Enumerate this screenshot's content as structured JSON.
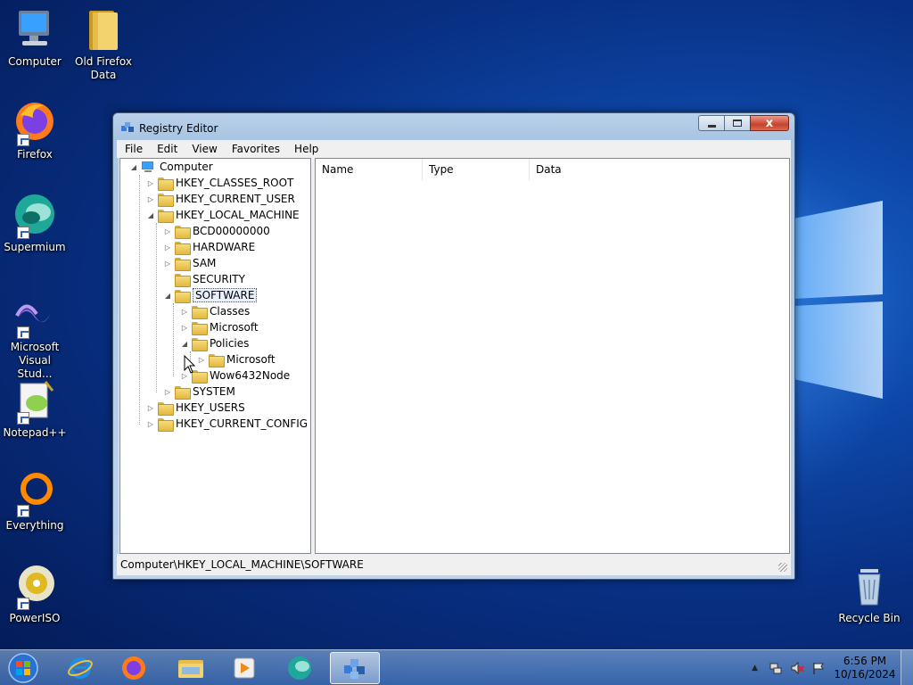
{
  "desktop": {
    "icons": [
      {
        "label": "Computer",
        "icon": "computer-icon"
      },
      {
        "label": "Old Firefox Data",
        "icon": "folder-icon"
      },
      {
        "label": "Firefox",
        "icon": "firefox-icon"
      },
      {
        "label": "Supermium",
        "icon": "supermium-icon"
      },
      {
        "label": "Microsoft Visual Stud...",
        "icon": "visual-studio-icon"
      },
      {
        "label": "Notepad++",
        "icon": "notepadpp-icon"
      },
      {
        "label": "Everything",
        "icon": "everything-icon"
      },
      {
        "label": "PowerISO",
        "icon": "poweriso-icon"
      },
      {
        "label": "Recycle Bin",
        "icon": "recycle-bin-icon"
      }
    ]
  },
  "window": {
    "title": "Registry Editor",
    "close_glyph": "x",
    "menu": [
      "File",
      "Edit",
      "View",
      "Favorites",
      "Help"
    ],
    "tree": [
      {
        "label": "Computer",
        "expander": ""
      },
      {
        "label": "HKEY_CLASSES_ROOT",
        "expander": "▷"
      },
      {
        "label": "HKEY_CURRENT_USER",
        "expander": "▷"
      },
      {
        "label": "HKEY_LOCAL_MACHINE",
        "expander": "◢"
      },
      {
        "label": "BCD00000000",
        "expander": "▷"
      },
      {
        "label": "HARDWARE",
        "expander": "▷"
      },
      {
        "label": "SAM",
        "expander": "▷"
      },
      {
        "label": "SECURITY",
        "expander": ""
      },
      {
        "label": "SOFTWARE",
        "expander": "◢"
      },
      {
        "label": "Classes",
        "expander": "▷"
      },
      {
        "label": "Microsoft",
        "expander": "▷"
      },
      {
        "label": "Policies",
        "expander": "◢"
      },
      {
        "label": "Microsoft",
        "expander": "▷"
      },
      {
        "label": "Wow6432Node",
        "expander": "▷"
      },
      {
        "label": "SYSTEM",
        "expander": "▷"
      },
      {
        "label": "HKEY_USERS",
        "expander": "▷"
      },
      {
        "label": "HKEY_CURRENT_CONFIG",
        "expander": "▷"
      }
    ],
    "columns": [
      "Name",
      "Type",
      "Data"
    ],
    "status": "Computer\\HKEY_LOCAL_MACHINE\\SOFTWARE"
  },
  "taskbar": {
    "apps": [
      "internet-explorer-icon",
      "firefox-icon",
      "file-explorer-icon",
      "media-player-icon",
      "supermium-icon",
      "regedit-icon"
    ],
    "active_app": "regedit-icon",
    "time": "6:56 PM",
    "date": "10/16/2024",
    "tray_expand": "▲"
  },
  "colors": {
    "accent_blue": "#0d47a8",
    "close_red": "#c7432c",
    "folder_yellow": "#e2b840"
  }
}
